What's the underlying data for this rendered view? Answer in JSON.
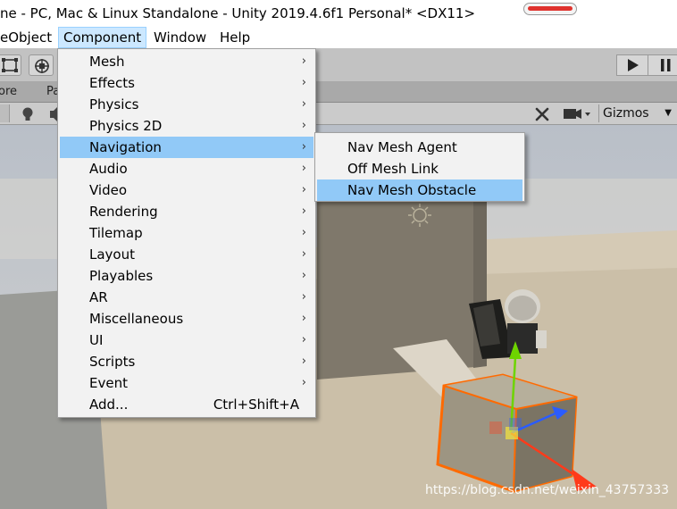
{
  "window": {
    "title": "ne - PC, Mac & Linux Standalone - Unity 2019.4.6f1 Personal* <DX11>"
  },
  "menubar": {
    "items": [
      "eObject",
      "Component",
      "Window",
      "Help"
    ]
  },
  "tabs": {
    "left": "ore",
    "right": "Pa"
  },
  "scene_toolbar": {
    "gizmos_label": "Gizmos"
  },
  "component_menu": {
    "items": [
      {
        "label": "Mesh",
        "chevron": "›"
      },
      {
        "label": "Effects",
        "chevron": "›"
      },
      {
        "label": "Physics",
        "chevron": "›"
      },
      {
        "label": "Physics 2D",
        "chevron": "›"
      },
      {
        "label": "Navigation",
        "chevron": "›"
      },
      {
        "label": "Audio",
        "chevron": "›"
      },
      {
        "label": "Video",
        "chevron": "›"
      },
      {
        "label": "Rendering",
        "chevron": "›"
      },
      {
        "label": "Tilemap",
        "chevron": "›"
      },
      {
        "label": "Layout",
        "chevron": "›"
      },
      {
        "label": "Playables",
        "chevron": "›"
      },
      {
        "label": "AR",
        "chevron": "›"
      },
      {
        "label": "Miscellaneous",
        "chevron": "›"
      },
      {
        "label": "UI",
        "chevron": "›"
      },
      {
        "label": "Scripts",
        "chevron": "›"
      },
      {
        "label": "Event",
        "chevron": "›"
      },
      {
        "label": "Add...",
        "shortcut": "Ctrl+Shift+A"
      }
    ],
    "highlighted": "Navigation"
  },
  "navigation_submenu": {
    "items": [
      {
        "label": "Nav Mesh Agent"
      },
      {
        "label": "Off Mesh Link"
      },
      {
        "label": "Nav Mesh Obstacle"
      }
    ],
    "highlighted": "Nav Mesh Obstacle"
  },
  "watermark": "https://blog.csdn.net/weixin_43757333",
  "colors": {
    "menu_highlight": "#91c9f7",
    "menubar_active": "#cce8ff",
    "gizmo_orange": "#ff6a00",
    "gizmo_green": "#6ed400",
    "gizmo_blue": "#2a5cff",
    "gizmo_red": "#ff3a1a"
  }
}
